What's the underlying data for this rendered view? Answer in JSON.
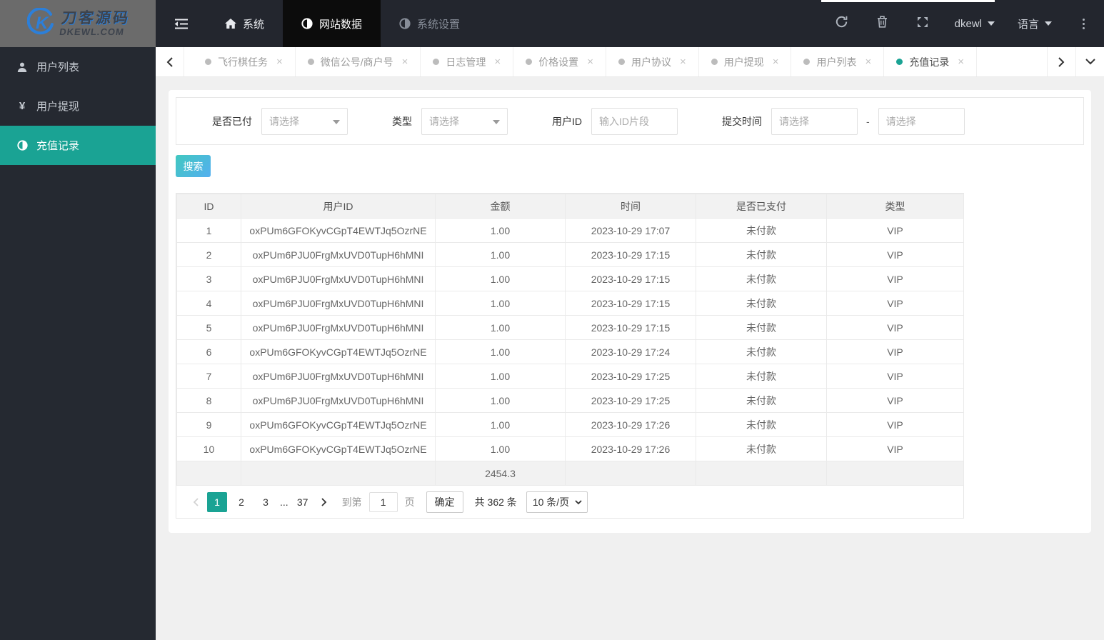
{
  "logo": {
    "title": "刀客源码",
    "subtitle": "DKEWL.COM"
  },
  "navbar": {
    "menus": [
      "系统",
      "网站数据",
      "系统设置"
    ],
    "user": "dkewl",
    "language_label": "语言"
  },
  "sidebar": {
    "items": [
      "用户列表",
      "用户提现",
      "充值记录"
    ]
  },
  "tabs": {
    "labels": [
      "飞行棋任务",
      "微信公号/商户号",
      "日志管理",
      "价格设置",
      "用户协议",
      "用户提现",
      "用户列表",
      "充值记录"
    ],
    "close_glyph": "×"
  },
  "filters": {
    "paid": {
      "label": "是否已付",
      "value": "请选择"
    },
    "type": {
      "label": "类型",
      "value": "请选择"
    },
    "user_id": {
      "label": "用户ID",
      "placeholder": "输入ID片段"
    },
    "time": {
      "label": "提交时间",
      "from_placeholder": "请选择",
      "to_placeholder": "请选择",
      "separator": "-"
    }
  },
  "search_label": "搜索",
  "table": {
    "columns": [
      "ID",
      "用户ID",
      "金额",
      "时间",
      "是否已支付",
      "类型"
    ],
    "rows": [
      {
        "id": "1",
        "user_id": "oxPUm6GFOKyvCGpT4EWTJq5OzrNE",
        "amount": "1.00",
        "time": "2023-10-29 17:07",
        "status": "未付款",
        "type": "VIP"
      },
      {
        "id": "2",
        "user_id": "oxPUm6PJU0FrgMxUVD0TupH6hMNI",
        "amount": "1.00",
        "time": "2023-10-29 17:15",
        "status": "未付款",
        "type": "VIP"
      },
      {
        "id": "3",
        "user_id": "oxPUm6PJU0FrgMxUVD0TupH6hMNI",
        "amount": "1.00",
        "time": "2023-10-29 17:15",
        "status": "未付款",
        "type": "VIP"
      },
      {
        "id": "4",
        "user_id": "oxPUm6PJU0FrgMxUVD0TupH6hMNI",
        "amount": "1.00",
        "time": "2023-10-29 17:15",
        "status": "未付款",
        "type": "VIP"
      },
      {
        "id": "5",
        "user_id": "oxPUm6PJU0FrgMxUVD0TupH6hMNI",
        "amount": "1.00",
        "time": "2023-10-29 17:15",
        "status": "未付款",
        "type": "VIP"
      },
      {
        "id": "6",
        "user_id": "oxPUm6GFOKyvCGpT4EWTJq5OzrNE",
        "amount": "1.00",
        "time": "2023-10-29 17:24",
        "status": "未付款",
        "type": "VIP"
      },
      {
        "id": "7",
        "user_id": "oxPUm6PJU0FrgMxUVD0TupH6hMNI",
        "amount": "1.00",
        "time": "2023-10-29 17:25",
        "status": "未付款",
        "type": "VIP"
      },
      {
        "id": "8",
        "user_id": "oxPUm6PJU0FrgMxUVD0TupH6hMNI",
        "amount": "1.00",
        "time": "2023-10-29 17:25",
        "status": "未付款",
        "type": "VIP"
      },
      {
        "id": "9",
        "user_id": "oxPUm6GFOKyvCGpT4EWTJq5OzrNE",
        "amount": "1.00",
        "time": "2023-10-29 17:26",
        "status": "未付款",
        "type": "VIP"
      },
      {
        "id": "10",
        "user_id": "oxPUm6GFOKyvCGpT4EWTJq5OzrNE",
        "amount": "1.00",
        "time": "2023-10-29 17:26",
        "status": "未付款",
        "type": "VIP"
      }
    ],
    "summary_amount": "2454.3"
  },
  "pagination": {
    "pages": [
      "1",
      "2",
      "3",
      "...",
      "37"
    ],
    "goto_label": "到第",
    "goto_value": "1",
    "page_unit": "页",
    "confirm_label": "确定",
    "total_text": "共 362 条",
    "page_size": "10 条/页"
  },
  "colors": {
    "accent": "#1aa394",
    "navbar_bg": "#23262e",
    "sidebar_bg": "#252931",
    "logo_bg": "#6b6b6b"
  }
}
